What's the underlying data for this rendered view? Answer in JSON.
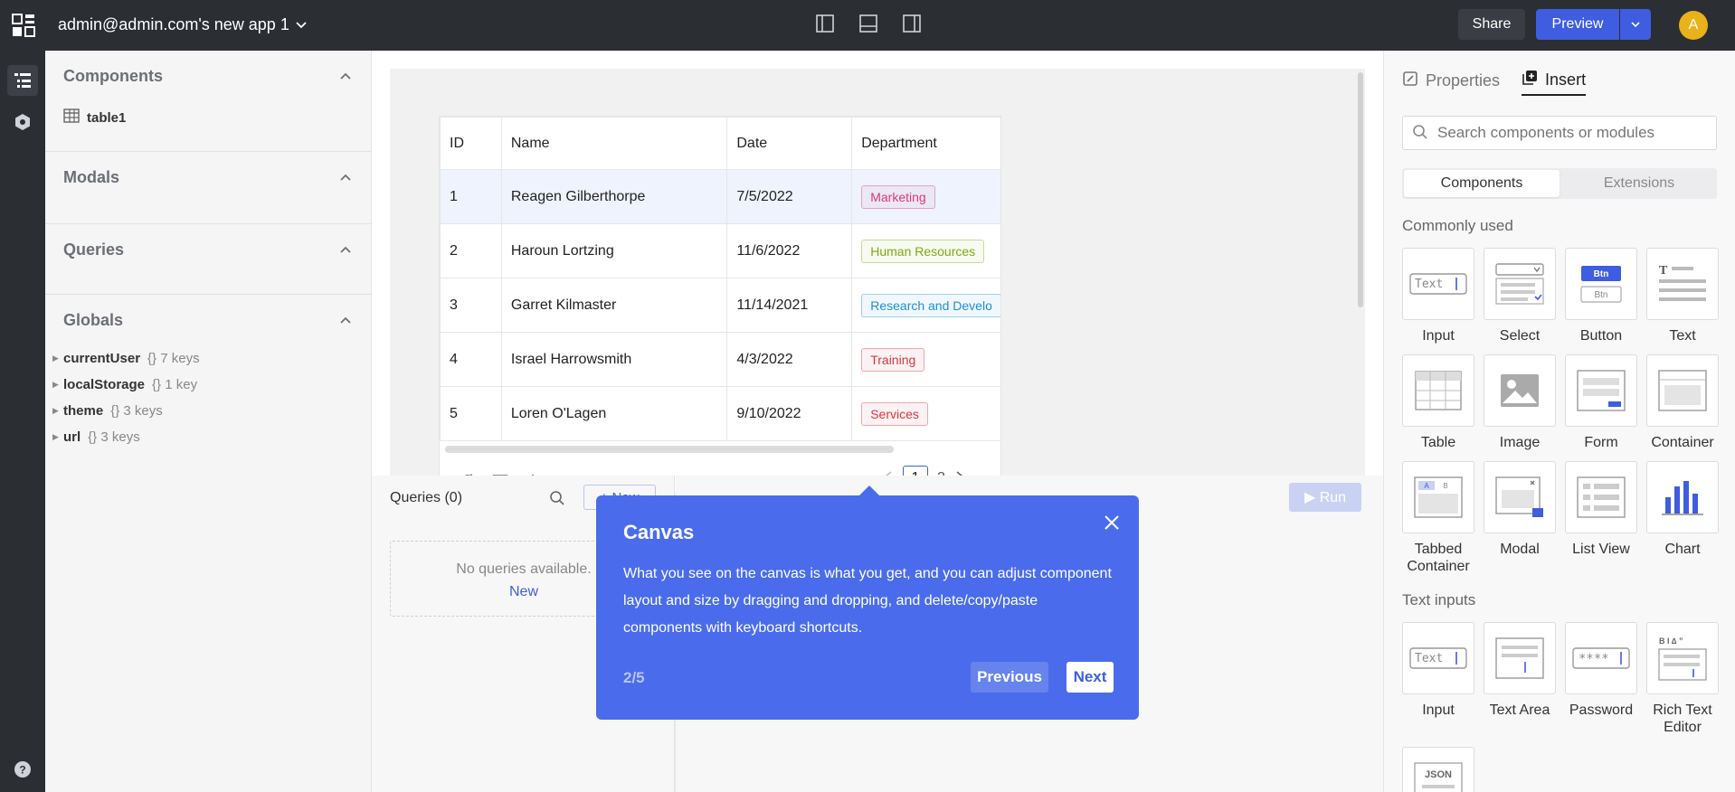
{
  "header": {
    "app_title": "admin@admin.com's new app 1",
    "share_label": "Share",
    "preview_label": "Preview",
    "avatar_initial": "A",
    "accent": "#3f5de0"
  },
  "left_panel": {
    "components": {
      "title": "Components",
      "items": [
        "table1"
      ]
    },
    "modals": {
      "title": "Modals"
    },
    "queries": {
      "title": "Queries"
    },
    "globals": {
      "title": "Globals",
      "items": [
        {
          "name": "currentUser",
          "keys": "{} 7 keys"
        },
        {
          "name": "localStorage",
          "keys": "{} 1 key"
        },
        {
          "name": "theme",
          "keys": "{} 3 keys"
        },
        {
          "name": "url",
          "keys": "{} 3 keys"
        }
      ]
    }
  },
  "table": {
    "columns": [
      "ID",
      "Name",
      "Date",
      "Department"
    ],
    "rows": [
      {
        "id": "1",
        "name": "Reagen Gilberthorpe",
        "date": "7/5/2022",
        "dept": "Marketing",
        "dept_color": "#d63b7a"
      },
      {
        "id": "2",
        "name": "Haroun Lortzing",
        "date": "11/6/2022",
        "dept": "Human Resources",
        "dept_color": "#7cab12"
      },
      {
        "id": "3",
        "name": "Garret Kilmaster",
        "date": "11/14/2021",
        "dept": "Research and Develo",
        "dept_color": "#1f8fd6"
      },
      {
        "id": "4",
        "name": "Israel Harrowsmith",
        "date": "4/3/2022",
        "dept": "Training",
        "dept_color": "#d9363e"
      },
      {
        "id": "5",
        "name": "Loren O'Lagen",
        "date": "9/10/2022",
        "dept": "Services",
        "dept_color": "#d9363e"
      }
    ],
    "pages": [
      "1",
      "2"
    ]
  },
  "query_panel": {
    "title": "Queries (0)",
    "new_label": "+ New",
    "empty_text": "No queries available.",
    "empty_link": "New",
    "run_label": "▶ Run"
  },
  "right_panel": {
    "tab_properties": "Properties",
    "tab_insert": "Insert",
    "search_placeholder": "Search components or modules",
    "seg_components": "Components",
    "seg_extensions": "Extensions",
    "group_common": "Commonly used",
    "group_text_inputs": "Text inputs",
    "common_tiles": [
      "Input",
      "Select",
      "Button",
      "Text",
      "Table",
      "Image",
      "Form",
      "Container",
      "Tabbed Container",
      "Modal",
      "List View",
      "Chart"
    ],
    "text_tiles": [
      "Input",
      "Text Area",
      "Password",
      "Rich Text Editor"
    ],
    "tile_glyphs": {
      "text": "Text",
      "password": "****",
      "json": "JSON",
      "btn": "Btn",
      "tab_a": "A",
      "tab_b": "B",
      "rich": "B I ∆ ”",
      "t": "T"
    }
  },
  "tour": {
    "title": "Canvas",
    "body": "What you see on the canvas is what you get, and you can adjust component layout and size by dragging and dropping, and delete/copy/paste components with keyboard shortcuts.",
    "step": "2/5",
    "previous_label": "Previous",
    "next_label": "Next",
    "bg_color": "#4a6cec"
  }
}
